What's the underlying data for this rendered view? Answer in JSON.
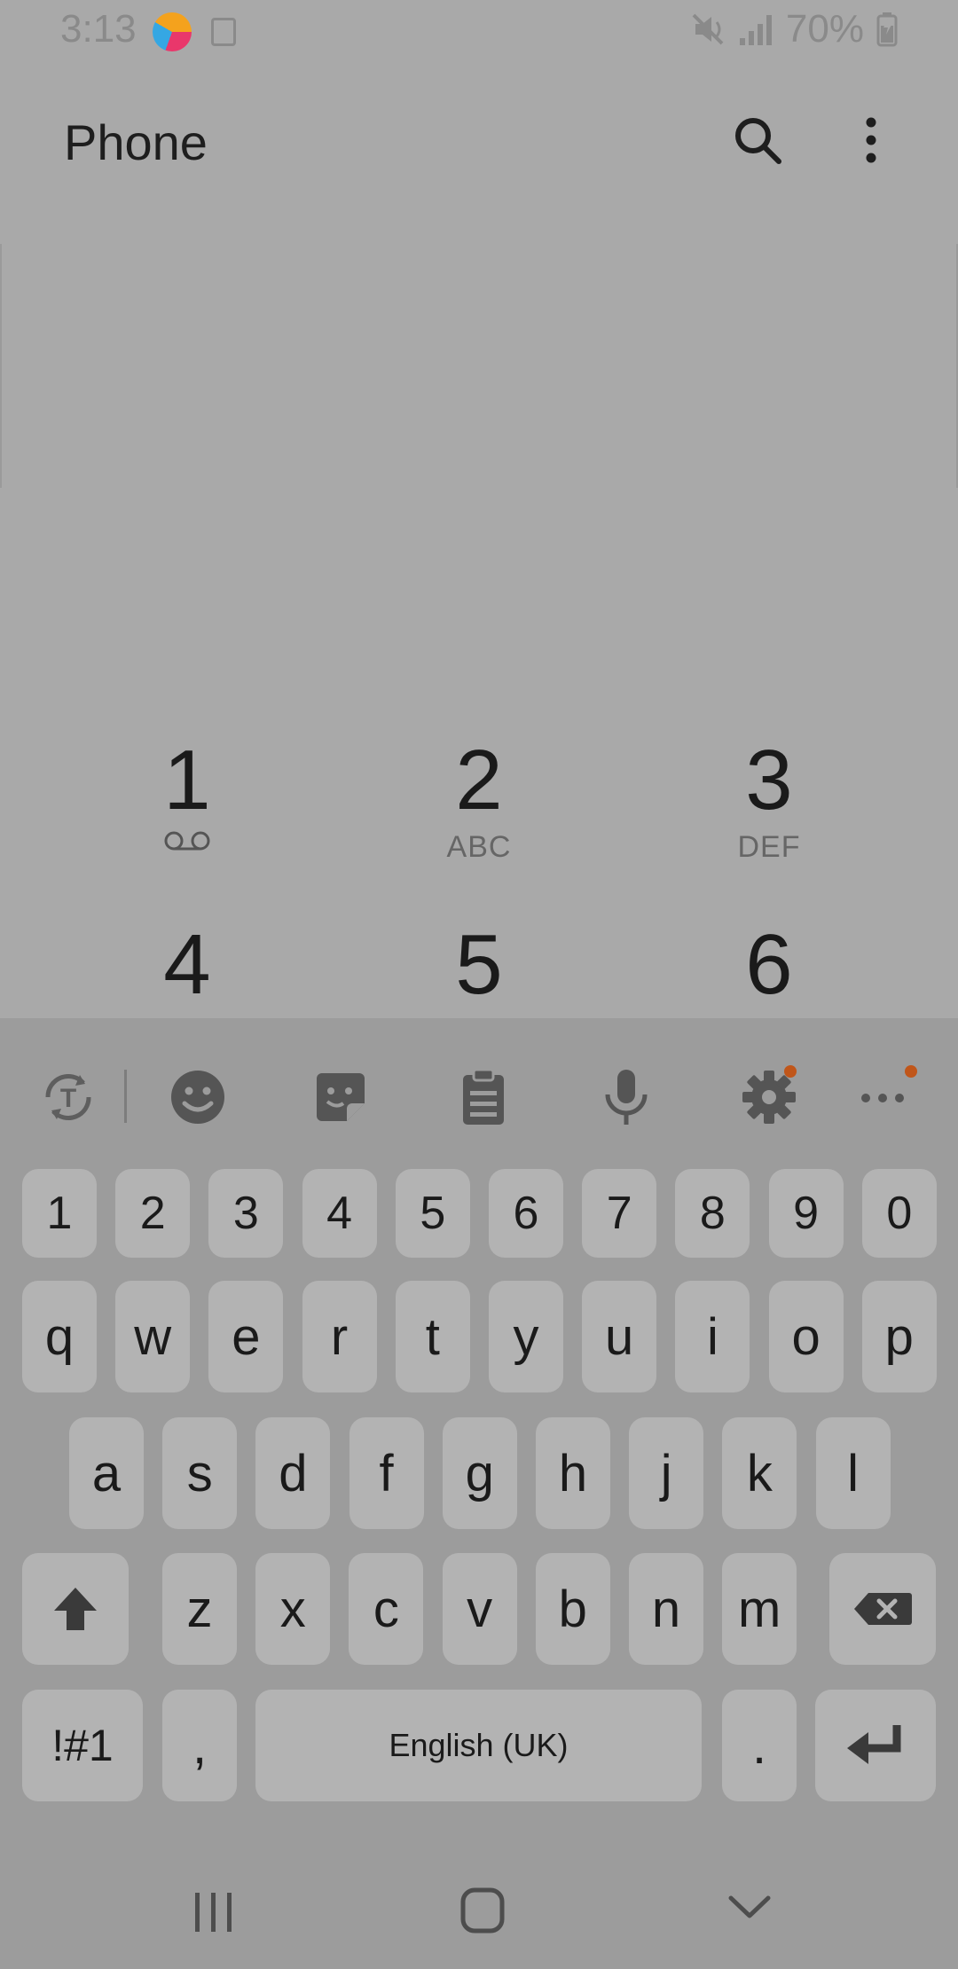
{
  "status_bar": {
    "time": "3:13",
    "battery": "70%"
  },
  "app_bar": {
    "title": "Phone"
  },
  "dialpad": [
    {
      "digit": "1",
      "sub": ""
    },
    {
      "digit": "2",
      "sub": "ABC"
    },
    {
      "digit": "3",
      "sub": "DEF"
    },
    {
      "digit": "4",
      "sub": ""
    },
    {
      "digit": "5",
      "sub": ""
    },
    {
      "digit": "6",
      "sub": ""
    }
  ],
  "keyboard": {
    "toolbar": [
      "text-mode-icon",
      "emoji-icon",
      "sticker-icon",
      "clipboard-icon",
      "mic-icon",
      "settings-icon",
      "more-icon"
    ],
    "number_row": [
      "1",
      "2",
      "3",
      "4",
      "5",
      "6",
      "7",
      "8",
      "9",
      "0"
    ],
    "row1": [
      "q",
      "w",
      "e",
      "r",
      "t",
      "y",
      "u",
      "i",
      "o",
      "p"
    ],
    "row2": [
      "a",
      "s",
      "d",
      "f",
      "g",
      "h",
      "j",
      "k",
      "l"
    ],
    "row3": [
      "z",
      "x",
      "c",
      "v",
      "b",
      "n",
      "m"
    ],
    "symbols_label": "!#1",
    "comma": ",",
    "space_label": "English (UK)",
    "period": "."
  },
  "colors": {
    "background": "#a9a9a9",
    "keyboard": "#9c9c9c",
    "key": "#b3b3b3",
    "badge": "#c0561a"
  }
}
